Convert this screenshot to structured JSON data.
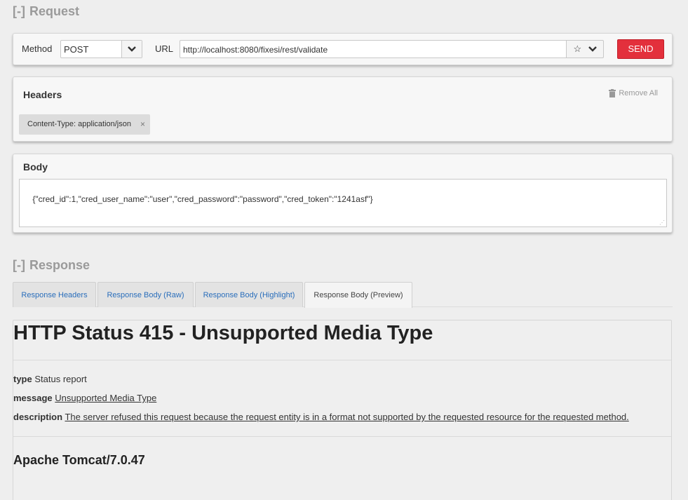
{
  "request": {
    "toggle": "[-]",
    "title": "Request",
    "method_label": "Method",
    "method_value": "POST",
    "url_label": "URL",
    "url_value": "http://localhost:8080/fixesi/rest/validate",
    "star_icon": "☆",
    "send_label": "SEND"
  },
  "headers": {
    "title": "Headers",
    "remove_all": "Remove All",
    "items": [
      {
        "text": "Content-Type: application/json"
      }
    ]
  },
  "body": {
    "title": "Body",
    "content": "{\"cred_id\":1,\"cred_user_name\":\"user\",\"cred_password\":\"password\",\"cred_token\":\"1241asf\"}"
  },
  "response": {
    "toggle": "[-]",
    "title": "Response",
    "tabs": [
      {
        "label": "Response Headers"
      },
      {
        "label": "Response Body (Raw)"
      },
      {
        "label": "Response Body (Highlight)"
      },
      {
        "label": "Response Body (Preview)",
        "active": true
      }
    ],
    "preview": {
      "heading": "HTTP Status 415 - Unsupported Media Type",
      "type_label": "type",
      "type_value": "Status report",
      "message_label": "message",
      "message_value": "Unsupported Media Type",
      "description_label": "description",
      "description_value": "The server refused this request because the request entity is in a format not supported by the requested resource for the requested method.",
      "footer": "Apache Tomcat/7.0.47"
    }
  },
  "colors": {
    "send": "#e3303c",
    "link": "#2a6ebb",
    "section_title": "#9a9a9a"
  }
}
